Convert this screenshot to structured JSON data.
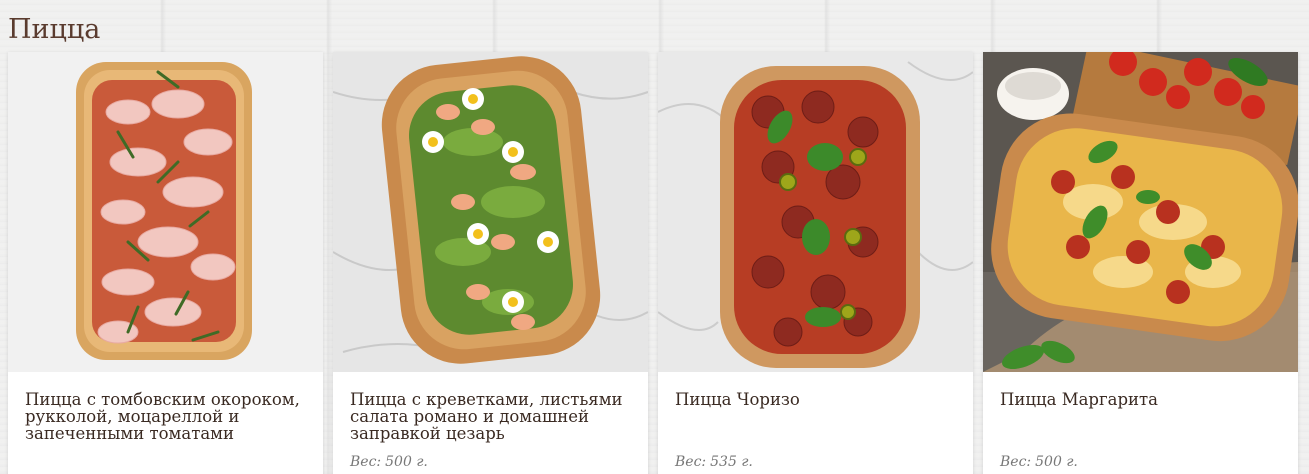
{
  "section": {
    "title": "Пицца"
  },
  "products": [
    {
      "name": "Пицца с томбовским окороком, рукколой, моцареллой и запеченными томатами",
      "weight_label": "",
      "weight_value": "",
      "photo_icon": "pizza-ham-arugula-image"
    },
    {
      "name": "Пицца с креветками, листьями салата романо и домашней заправкой цезарь",
      "weight_label": "Вес:",
      "weight_value": "500 г.",
      "photo_icon": "pizza-shrimp-caesar-image"
    },
    {
      "name": "Пицца Чоризо",
      "weight_label": "Вес:",
      "weight_value": "535 г.",
      "photo_icon": "pizza-chorizo-image"
    },
    {
      "name": "Пицца Маргарита",
      "weight_label": "Вес:",
      "weight_value": "500 г.",
      "photo_icon": "pizza-margherita-image"
    }
  ],
  "colors": {
    "title": "#5a3b2e",
    "text": "#3a2a22",
    "weight": "#777777",
    "background": "#f1f1f0"
  }
}
